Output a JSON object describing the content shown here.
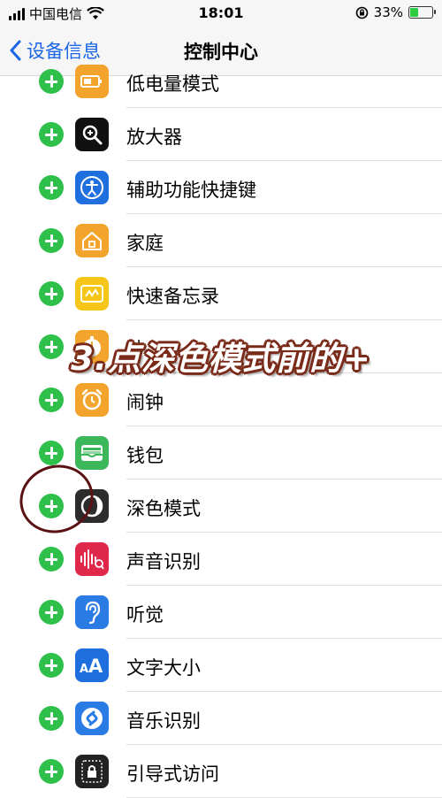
{
  "status_bar": {
    "carrier": "中国电信",
    "time": "18:01",
    "battery_percent": "33%",
    "battery_level": 0.33
  },
  "nav": {
    "back_label": "设备信息",
    "title": "控制中心"
  },
  "rows": [
    {
      "label": "低电量模式",
      "icon": "battery-icon",
      "color": "#f2a42c"
    },
    {
      "label": "放大器",
      "icon": "magnifier-icon",
      "color": "#111111"
    },
    {
      "label": "辅助功能快捷键",
      "icon": "accessibility-icon",
      "color": "#1f6fde"
    },
    {
      "label": "家庭",
      "icon": "home-icon",
      "color": "#f2a42c"
    },
    {
      "label": "快速备忘录",
      "icon": "quick-note-icon",
      "color": "#f5c518"
    },
    {
      "label": "秒",
      "icon": "stopwatch-icon",
      "color": "#f2a42c"
    },
    {
      "label": "闹钟",
      "icon": "alarm-icon",
      "color": "#f2a42c"
    },
    {
      "label": "钱包",
      "icon": "wallet-icon",
      "color": "#3cb85a"
    },
    {
      "label": "深色模式",
      "icon": "dark-mode-icon",
      "color": "#2c2c2c"
    },
    {
      "label": "声音识别",
      "icon": "sound-recognition-icon",
      "color": "#e0284a"
    },
    {
      "label": "听觉",
      "icon": "hearing-icon",
      "color": "#2a7be4"
    },
    {
      "label": "文字大小",
      "icon": "text-size-icon",
      "color": "#1f6fde"
    },
    {
      "label": "音乐识别",
      "icon": "shazam-icon",
      "color": "#2a7be4"
    },
    {
      "label": "引导式访问",
      "icon": "guided-access-icon",
      "color": "#222222"
    }
  ],
  "overlay_text": "3.点深色模式前的+"
}
